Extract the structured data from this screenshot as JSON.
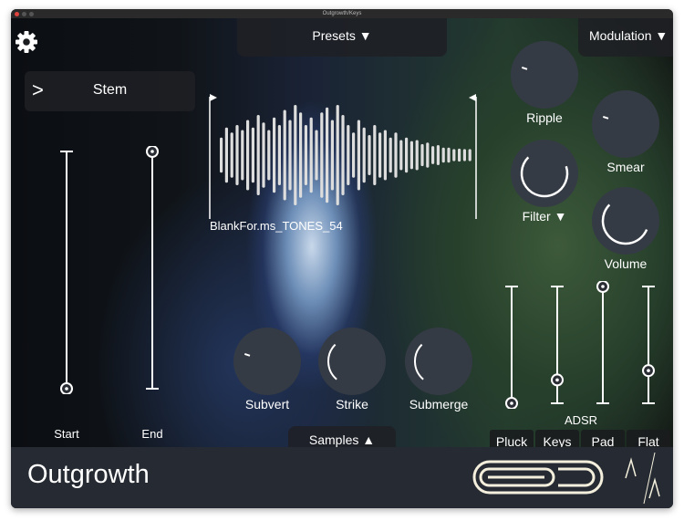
{
  "window": {
    "title": "Outgrowth/Keys"
  },
  "header": {
    "presets_label": "Presets ▼",
    "modulation_label": "Modulation ▼"
  },
  "stem": {
    "label": "Stem"
  },
  "sample": {
    "filename": "BlankFor.ms_TONES_54",
    "waveform": [
      0.35,
      0.55,
      0.45,
      0.6,
      0.5,
      0.7,
      0.55,
      0.8,
      0.65,
      0.5,
      0.75,
      0.6,
      0.9,
      0.7,
      1.0,
      0.85,
      0.6,
      0.75,
      0.5,
      0.85,
      0.95,
      0.7,
      1.0,
      0.8,
      0.6,
      0.45,
      0.7,
      0.55,
      0.4,
      0.6,
      0.45,
      0.5,
      0.35,
      0.45,
      0.3,
      0.35,
      0.28,
      0.3,
      0.22,
      0.25,
      0.18,
      0.2,
      0.15,
      0.15,
      0.12,
      0.13,
      0.12,
      0.12
    ]
  },
  "range": {
    "start_label": "Start",
    "end_label": "End",
    "start_value": 0,
    "end_value": 1
  },
  "knobs": [
    {
      "id": "ripple",
      "label": "Ripple",
      "value": 0.1,
      "ring": false
    },
    {
      "id": "smear",
      "label": "Smear",
      "value": 0.1,
      "ring": false
    },
    {
      "id": "filter",
      "label": "Filter ▼",
      "value": 0.9,
      "ring": true
    },
    {
      "id": "volume",
      "label": "Volume",
      "value": 0.75,
      "ring": true
    },
    {
      "id": "subvert",
      "label": "Subvert",
      "value": 0.1,
      "ring": false
    },
    {
      "id": "strike",
      "label": "Strike",
      "value": 0.35,
      "ring": false
    },
    {
      "id": "submerge",
      "label": "Submerge",
      "value": 0.35,
      "ring": false
    }
  ],
  "adsr": {
    "label": "ADSR",
    "values": [
      0,
      0.2,
      1,
      0.28
    ],
    "presets": [
      "Pluck",
      "Keys",
      "Pad",
      "Flat"
    ]
  },
  "samples_label": "Samples ▲",
  "footer": {
    "title": "Outgrowth"
  },
  "colors": {
    "knob": "#353b45",
    "footer": "#262b33",
    "logo": "#f3efdc"
  }
}
